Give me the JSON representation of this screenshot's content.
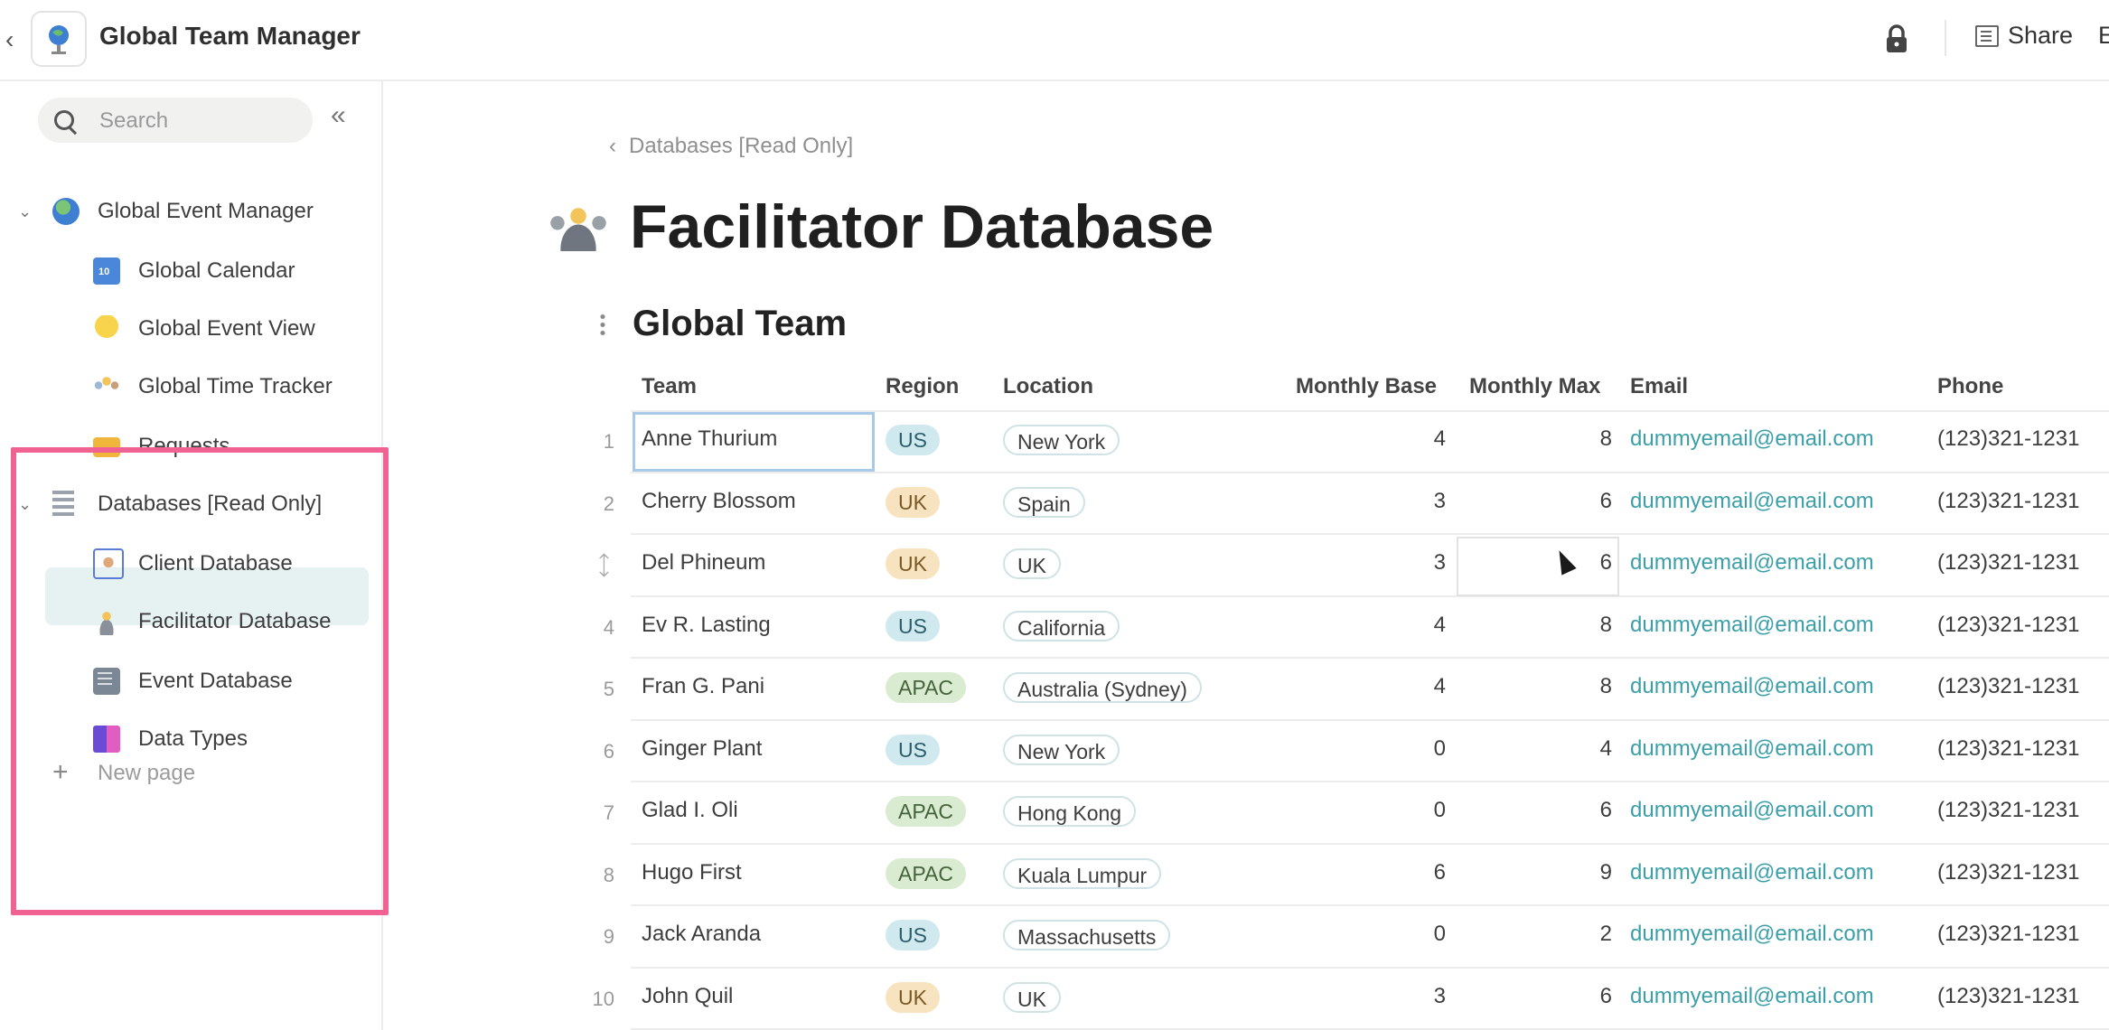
{
  "topbar": {
    "title": "Global Team Manager",
    "share_label": "Share",
    "edge_label": "E",
    "icons": [
      "chevron-left-icon",
      "globe-doc-icon",
      "lock-icon",
      "share-icon"
    ]
  },
  "sidebar": {
    "search_placeholder": "Search",
    "collapse_glyph": "«",
    "groups": [
      {
        "label": "Global Event Manager",
        "icon": "globe-icon",
        "items": [
          {
            "label": "Global Calendar",
            "icon": "calendar-icon"
          },
          {
            "label": "Global Event View",
            "icon": "lightbulb-icon"
          },
          {
            "label": "Global Time Tracker",
            "icon": "people-icon"
          },
          {
            "label": "Requests",
            "icon": "ticket-icon"
          }
        ]
      },
      {
        "label": "Databases [Read Only]",
        "icon": "database-icon",
        "items": [
          {
            "label": "Client Database",
            "icon": "client-icon"
          },
          {
            "label": "Facilitator Database",
            "icon": "facilitator-icon",
            "selected": true
          },
          {
            "label": "Event Database",
            "icon": "event-db-icon"
          },
          {
            "label": "Data Types",
            "icon": "data-types-icon"
          }
        ]
      }
    ],
    "new_page_label": "New page"
  },
  "main": {
    "breadcrumb": "Databases [Read Only]",
    "page_title": "Facilitator Database",
    "section_title": "Global Team",
    "table": {
      "columns": [
        "Team",
        "Region",
        "Location",
        "Monthly Base",
        "Monthly Max",
        "Email",
        "Phone"
      ],
      "rows": [
        {
          "n": "1",
          "team": "Anne Thurium",
          "region": "US",
          "location": "New York",
          "base": "4",
          "max": "8",
          "email": "dummyemail@email.com",
          "phone": "(123)321-1231"
        },
        {
          "n": "2",
          "team": "Cherry Blossom",
          "region": "UK",
          "location": "Spain",
          "base": "3",
          "max": "6",
          "email": "dummyemail@email.com",
          "phone": "(123)321-1231"
        },
        {
          "n": "",
          "team": "Del Phineum",
          "region": "UK",
          "location": "UK",
          "base": "3",
          "max": "6",
          "email": "dummyemail@email.com",
          "phone": "(123)321-1231"
        },
        {
          "n": "4",
          "team": "Ev R. Lasting",
          "region": "US",
          "location": "California",
          "base": "4",
          "max": "8",
          "email": "dummyemail@email.com",
          "phone": "(123)321-1231"
        },
        {
          "n": "5",
          "team": "Fran G. Pani",
          "region": "APAC",
          "location": "Australia (Sydney)",
          "base": "4",
          "max": "8",
          "email": "dummyemail@email.com",
          "phone": "(123)321-1231"
        },
        {
          "n": "6",
          "team": "Ginger Plant",
          "region": "US",
          "location": "New York",
          "base": "0",
          "max": "4",
          "email": "dummyemail@email.com",
          "phone": "(123)321-1231"
        },
        {
          "n": "7",
          "team": "Glad I. Oli",
          "region": "APAC",
          "location": "Hong Kong",
          "base": "0",
          "max": "6",
          "email": "dummyemail@email.com",
          "phone": "(123)321-1231"
        },
        {
          "n": "8",
          "team": "Hugo First",
          "region": "APAC",
          "location": "Kuala Lumpur",
          "base": "6",
          "max": "9",
          "email": "dummyemail@email.com",
          "phone": "(123)321-1231"
        },
        {
          "n": "9",
          "team": "Jack Aranda",
          "region": "US",
          "location": "Massachusetts",
          "base": "0",
          "max": "2",
          "email": "dummyemail@email.com",
          "phone": "(123)321-1231"
        },
        {
          "n": "10",
          "team": "John Quil",
          "region": "UK",
          "location": "UK",
          "base": "3",
          "max": "6",
          "email": "dummyemail@email.com",
          "phone": "(123)321-1231"
        }
      ]
    }
  },
  "colors": {
    "highlight_border": "#f06292",
    "selected_item_bg": "#e6f1f1",
    "email_link": "#3a9fa8",
    "region_us": "#cfe9ef",
    "region_uk": "#f7e3bf",
    "region_apac": "#d9ebd0"
  }
}
